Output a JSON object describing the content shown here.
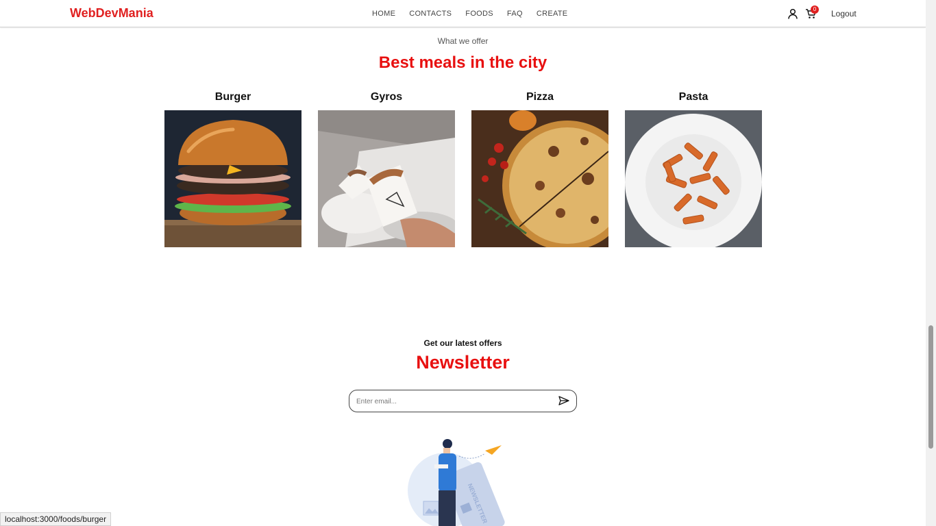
{
  "header": {
    "logo": "WebDevMania",
    "nav": [
      "HOME",
      "CONTACTS",
      "FOODS",
      "FAQ",
      "CREATE"
    ],
    "cart_count": "0",
    "logout": "Logout"
  },
  "offer": {
    "subtitle": "What we offer",
    "title": "Best meals in the city",
    "foods": [
      {
        "name": "Burger"
      },
      {
        "name": "Gyros"
      },
      {
        "name": "Pizza"
      },
      {
        "name": "Pasta"
      }
    ]
  },
  "newsletter": {
    "subtitle": "Get our latest offers",
    "title": "Newsletter",
    "email_placeholder": "Enter email...",
    "illustration_text": "NEWSLETTER"
  },
  "status_bar": "localhost:3000/foods/burger",
  "colors": {
    "brand": "#e02020",
    "accent": "#e81010"
  }
}
